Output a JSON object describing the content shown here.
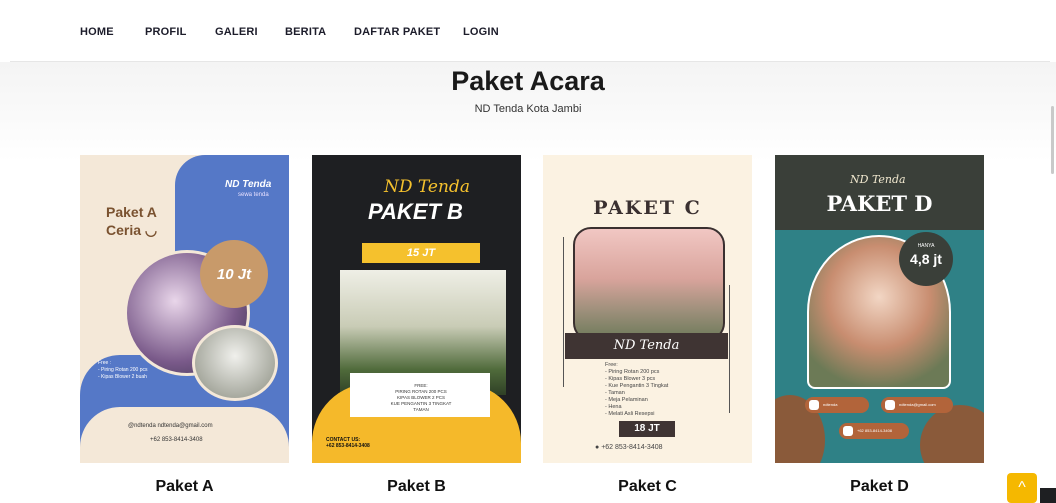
{
  "nav": {
    "items": [
      {
        "label": "HOME"
      },
      {
        "label": "PROFIL"
      },
      {
        "label": "GALERI"
      },
      {
        "label": "BERITA"
      },
      {
        "label": "DAFTAR PAKET"
      },
      {
        "label": "LOGIN"
      }
    ]
  },
  "hero": {
    "title": "Paket Acara",
    "subtitle": "ND Tenda Kota Jambi"
  },
  "packages": [
    {
      "label": "Paket A",
      "poster": {
        "title_line1": "Paket A",
        "title_line2": "Ceria ◡",
        "brand": "ND Tenda",
        "brand_sub": "sewa tenda",
        "price": "10 Jt",
        "free_text": "Free :",
        "free_items": "- Piring Rotan 200 pcs\n- Kipas Blower 2 buah",
        "contact1": "@ndtenda  ndtenda@gmail.com",
        "contact2": "+62 853-8414-3408"
      }
    },
    {
      "label": "Paket B",
      "poster": {
        "brand": "ND Tenda",
        "title": "PAKET B",
        "price": "15 JT",
        "free_items": "FREE:\nPIRING ROTAN 200 PCS\nKIPAS BLOWER 2 PCS\nKUE PENGANTIN 3 TINGKAT\nTAMAN",
        "contact": "CONTACT US:\n+62 853-8414-3408"
      }
    },
    {
      "label": "Paket C",
      "poster": {
        "title": "PAKET C",
        "brand": "ND Tenda",
        "free_items": "Free:\n- Piring Rotan 200 pcs\n- Kipas Blower 3 pcs\n- Kue Pengantin 3 Tingkat\n- Taman\n- Meja Pelaminan\n- Hena\n- Melati Asli Resepsi",
        "price": "18 JT",
        "contact": "+62 853-8414-3408"
      }
    },
    {
      "label": "Paket D",
      "poster": {
        "brand": "ND Tenda",
        "title": "PAKET D",
        "badge_small": "HANYA",
        "price": "4,8 jt",
        "chip1": "ndtenda",
        "chip2": "ndtenda@gmail.com",
        "chip3": "+62 853-8414-3408"
      }
    }
  ],
  "scroll_top": {
    "glyph": "^"
  }
}
